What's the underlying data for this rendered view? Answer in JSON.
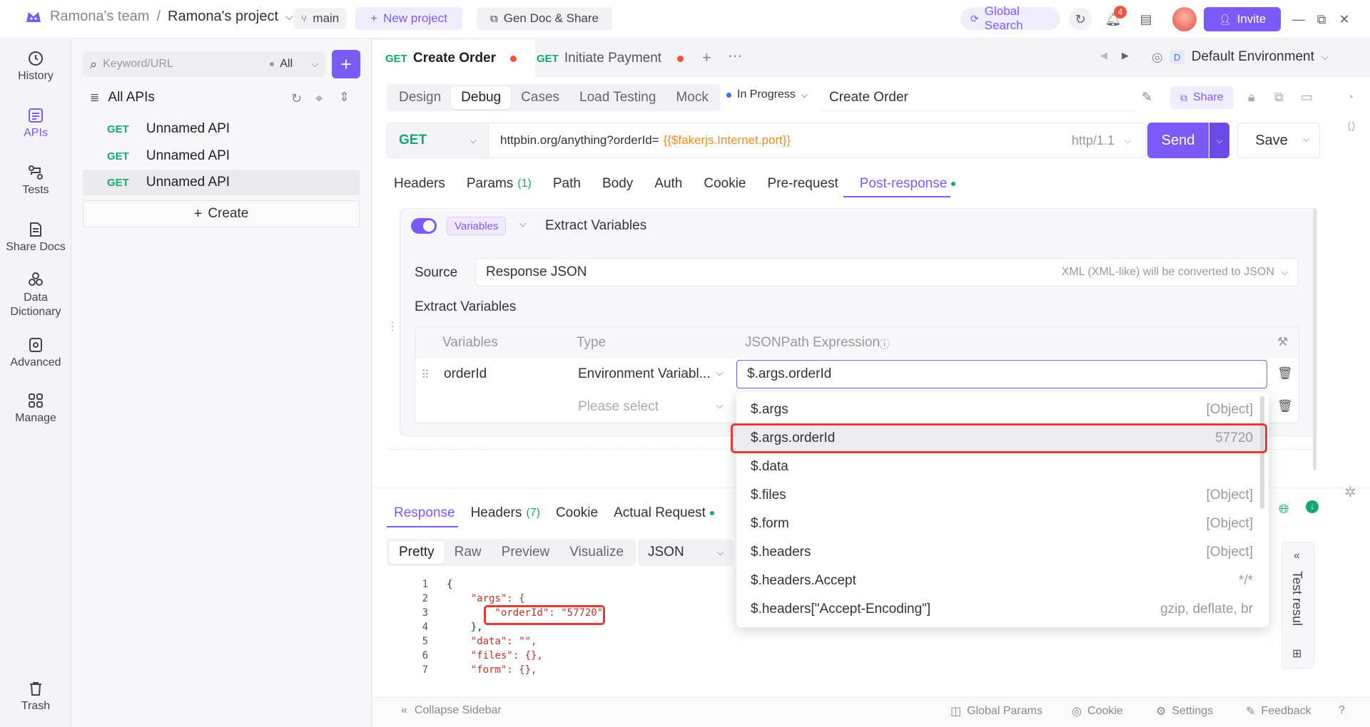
{
  "topbar": {
    "team": "Ramona's team",
    "separator": "/",
    "project": "Ramona's project",
    "branch": "main",
    "new_project": "New project",
    "gen_doc": "Gen Doc & Share",
    "global_search": "Global Search",
    "notification_count": "4",
    "invite": "Invite"
  },
  "rail": [
    {
      "label": "History",
      "icon": "history-icon"
    },
    {
      "label": "APIs",
      "icon": "apis-icon"
    },
    {
      "label": "Tests",
      "icon": "tests-icon"
    },
    {
      "label": "Share Docs",
      "icon": "share-docs-icon"
    },
    {
      "label": "Data",
      "label2": "Dictionary",
      "icon": "data-dictionary-icon"
    },
    {
      "label": "Advanced",
      "icon": "advanced-icon"
    },
    {
      "label": "Manage",
      "icon": "manage-icon"
    },
    {
      "label": "Trash",
      "icon": "trash-icon"
    }
  ],
  "sidebar": {
    "search_placeholder": "Keyword/URL",
    "filter": "All",
    "all_apis": "All APIs",
    "items": [
      {
        "method": "GET",
        "name": "Unnamed API"
      },
      {
        "method": "GET",
        "name": "Unnamed API"
      },
      {
        "method": "GET",
        "name": "Unnamed API"
      }
    ],
    "create": "Create"
  },
  "tabs": [
    {
      "method": "GET",
      "name": "Create Order"
    },
    {
      "method": "GET",
      "name": "Initiate Payment"
    }
  ],
  "environment": {
    "badge": "D",
    "name": "Default Environment"
  },
  "modes": [
    "Design",
    "Debug",
    "Cases",
    "Load Testing",
    "Mock"
  ],
  "status": "In Progress",
  "api_name": "Create Order",
  "share": "Share",
  "request": {
    "method": "GET",
    "url": "httpbin.org/anything?orderId=",
    "url_var": "{{$fakerjs.Internet.port}}",
    "protocol": "http/1.1",
    "send": "Send",
    "save": "Save"
  },
  "req_tabs": {
    "headers": "Headers",
    "params": "Params",
    "params_count": "(1)",
    "path": "Path",
    "body": "Body",
    "auth": "Auth",
    "cookie": "Cookie",
    "pre": "Pre-request",
    "post": "Post-response"
  },
  "extract": {
    "badge": "Variables",
    "title": "Extract Variables",
    "source_label": "Source",
    "source_value": "Response JSON",
    "source_hint": "XML (XML-like) will be converted to JSON",
    "section": "Extract Variables",
    "col_vars": "Variables",
    "col_type": "Type",
    "col_path": "JSONPath Expression",
    "row_var": "orderId",
    "row_type": "Environment Variabl...",
    "row_path": "$.args.orderId",
    "placeholder_type": "Please select"
  },
  "dropdown": [
    {
      "path": "$.args",
      "value": "[Object]"
    },
    {
      "path": "$.args.orderId",
      "value": "57720"
    },
    {
      "path": "$.data",
      "value": ""
    },
    {
      "path": "$.files",
      "value": "[Object]"
    },
    {
      "path": "$.form",
      "value": "[Object]"
    },
    {
      "path": "$.headers",
      "value": "[Object]"
    },
    {
      "path": "$.headers.Accept",
      "value": "*/*"
    },
    {
      "path": "$.headers[\"Accept-Encoding\"]",
      "value": "gzip, deflate, br"
    }
  ],
  "response": {
    "tab_response": "Response",
    "tab_headers": "Headers",
    "headers_count": "(7)",
    "tab_cookie": "Cookie",
    "tab_actual": "Actual Request",
    "views": [
      "Pretty",
      "Raw",
      "Preview",
      "Visualize"
    ],
    "format": "JSON",
    "test_results": "Test resul",
    "lines": [
      {
        "n": "1",
        "t": "{"
      },
      {
        "n": "2",
        "t": "    \"args\": {"
      },
      {
        "n": "3",
        "t": "        \"orderId\": \"57720\""
      },
      {
        "n": "4",
        "t": "    },"
      },
      {
        "n": "5",
        "t": "    \"data\": \"\","
      },
      {
        "n": "6",
        "t": "    \"files\": {},"
      },
      {
        "n": "7",
        "t": "    \"form\": {},"
      }
    ]
  },
  "footer": {
    "collapse": "Collapse Sidebar",
    "global_params": "Global Params",
    "cookie": "Cookie",
    "settings": "Settings",
    "feedback": "Feedback"
  },
  "colors": {
    "accent": "#7a5af8",
    "get": "#17a673",
    "highlight": "#e53935"
  }
}
